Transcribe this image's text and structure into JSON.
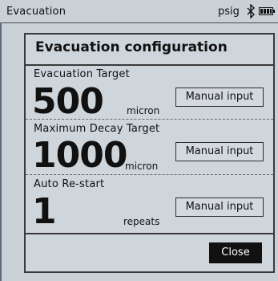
{
  "status_bar": {
    "title": "Evacuation",
    "unit": "psig",
    "icons": [
      "bluetooth-icon",
      "battery-icon"
    ]
  },
  "dialog": {
    "title": "Evacuation configuration",
    "sections": [
      {
        "label": "Evacuation Target",
        "value": "500",
        "unit": "micron",
        "button_label": "Manual input"
      },
      {
        "label": "Maximum Decay Target",
        "value": "1000",
        "unit": "micron",
        "button_label": "Manual input"
      },
      {
        "label": "Auto Re-start",
        "value": "1",
        "unit": "repeats",
        "button_label": "Manual input"
      }
    ],
    "close_label": "Close"
  }
}
